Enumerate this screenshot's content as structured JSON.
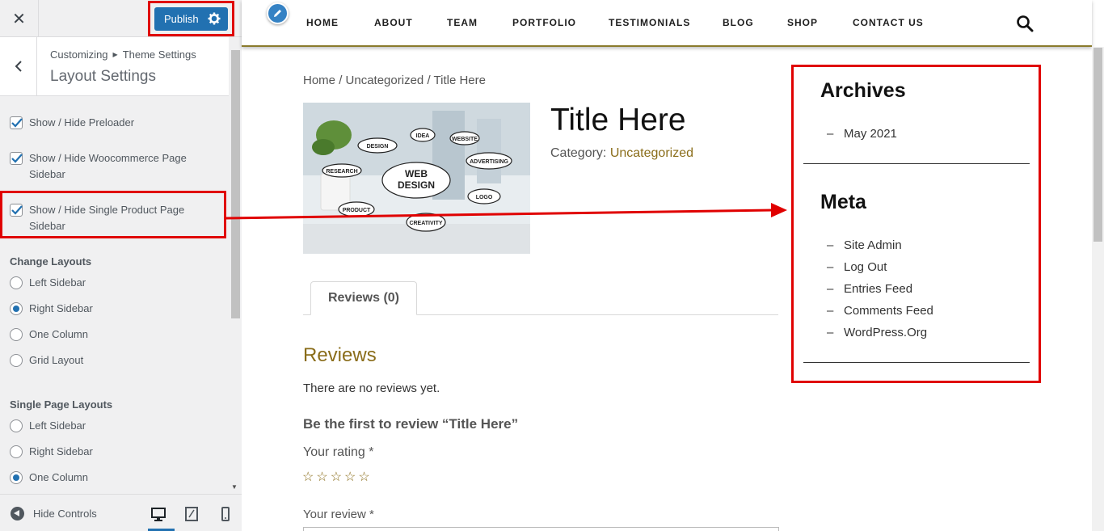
{
  "customizer": {
    "close_icon": "close-icon",
    "publish_label": "Publish",
    "breadcrumb_root": "Customizing",
    "breadcrumb_section": "Theme Settings",
    "panel_title": "Layout Settings",
    "checkboxes": [
      {
        "label_line1": "Show / Hide Preloader",
        "label_line2": "",
        "checked": true
      },
      {
        "label_line1": "Show / Hide Woocommerce Page",
        "label_line2": "Sidebar",
        "checked": true
      },
      {
        "label_line1": "Show / Hide Single Product Page",
        "label_line2": "Sidebar",
        "checked": true
      }
    ],
    "change_layouts": {
      "title": "Change Layouts",
      "options": [
        "Left Sidebar",
        "Right Sidebar",
        "One Column",
        "Grid Layout"
      ],
      "selected": "Right Sidebar"
    },
    "single_page_layouts": {
      "title": "Single Page Layouts",
      "options": [
        "Left Sidebar",
        "Right Sidebar",
        "One Column"
      ],
      "selected": "One Column"
    },
    "footer": {
      "hide_controls_label": "Hide Controls",
      "devices": [
        "desktop-icon",
        "tablet-icon",
        "mobile-icon"
      ],
      "active_device": "desktop"
    }
  },
  "preview": {
    "nav": [
      "HOME",
      "ABOUT",
      "TEAM",
      "PORTFOLIO",
      "TESTIMONIALS",
      "BLOG",
      "SHOP",
      "CONTACT US"
    ],
    "breadcrumb": {
      "home": "Home",
      "sep": "/",
      "category": "Uncategorized",
      "current": "Title Here"
    },
    "product": {
      "title": "Title Here",
      "category_label": "Category:",
      "category_value": "Uncategorized",
      "image_words": [
        "DESIGN",
        "IDEA",
        "WEBSITE",
        "RESEARCH",
        "WEB",
        "DESIGN",
        "ADVERTISING",
        "LOGO",
        "PRODUCT",
        "CREATIVITY"
      ]
    },
    "tab_label": "Reviews (0)",
    "reviews_heading": "Reviews",
    "no_reviews": "There are no reviews yet.",
    "be_first": "Be the first to review “Title Here”",
    "rating_label": "Your rating *",
    "stars": [
      "☆",
      "☆",
      "☆",
      "☆",
      "☆"
    ],
    "review_label": "Your review *",
    "sidebar": {
      "archives_title": "Archives",
      "archives": [
        "May 2021"
      ],
      "meta_title": "Meta",
      "meta": [
        "Site Admin",
        "Log Out",
        "Entries Feed",
        "Comments Feed",
        "WordPress.Org"
      ]
    }
  },
  "colors": {
    "accent": "#2271b1",
    "highlight": "#e00000",
    "link": "#8a6d1a"
  }
}
